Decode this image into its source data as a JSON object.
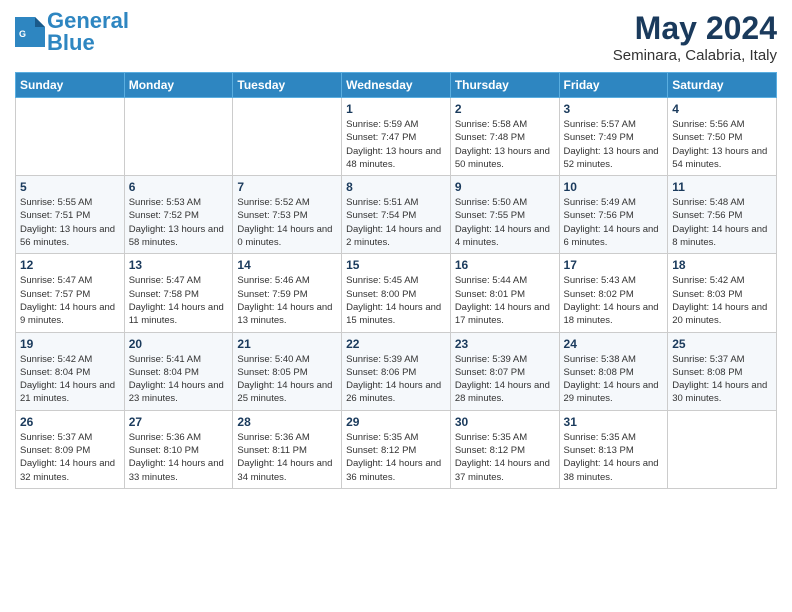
{
  "logo": {
    "text_general": "General",
    "text_blue": "Blue"
  },
  "header": {
    "month_title": "May 2024",
    "location": "Seminara, Calabria, Italy"
  },
  "days_of_week": [
    "Sunday",
    "Monday",
    "Tuesday",
    "Wednesday",
    "Thursday",
    "Friday",
    "Saturday"
  ],
  "weeks": [
    [
      {
        "day": "",
        "sunrise": "",
        "sunset": "",
        "daylight": ""
      },
      {
        "day": "",
        "sunrise": "",
        "sunset": "",
        "daylight": ""
      },
      {
        "day": "",
        "sunrise": "",
        "sunset": "",
        "daylight": ""
      },
      {
        "day": "1",
        "sunrise": "Sunrise: 5:59 AM",
        "sunset": "Sunset: 7:47 PM",
        "daylight": "Daylight: 13 hours and 48 minutes."
      },
      {
        "day": "2",
        "sunrise": "Sunrise: 5:58 AM",
        "sunset": "Sunset: 7:48 PM",
        "daylight": "Daylight: 13 hours and 50 minutes."
      },
      {
        "day": "3",
        "sunrise": "Sunrise: 5:57 AM",
        "sunset": "Sunset: 7:49 PM",
        "daylight": "Daylight: 13 hours and 52 minutes."
      },
      {
        "day": "4",
        "sunrise": "Sunrise: 5:56 AM",
        "sunset": "Sunset: 7:50 PM",
        "daylight": "Daylight: 13 hours and 54 minutes."
      }
    ],
    [
      {
        "day": "5",
        "sunrise": "Sunrise: 5:55 AM",
        "sunset": "Sunset: 7:51 PM",
        "daylight": "Daylight: 13 hours and 56 minutes."
      },
      {
        "day": "6",
        "sunrise": "Sunrise: 5:53 AM",
        "sunset": "Sunset: 7:52 PM",
        "daylight": "Daylight: 13 hours and 58 minutes."
      },
      {
        "day": "7",
        "sunrise": "Sunrise: 5:52 AM",
        "sunset": "Sunset: 7:53 PM",
        "daylight": "Daylight: 14 hours and 0 minutes."
      },
      {
        "day": "8",
        "sunrise": "Sunrise: 5:51 AM",
        "sunset": "Sunset: 7:54 PM",
        "daylight": "Daylight: 14 hours and 2 minutes."
      },
      {
        "day": "9",
        "sunrise": "Sunrise: 5:50 AM",
        "sunset": "Sunset: 7:55 PM",
        "daylight": "Daylight: 14 hours and 4 minutes."
      },
      {
        "day": "10",
        "sunrise": "Sunrise: 5:49 AM",
        "sunset": "Sunset: 7:56 PM",
        "daylight": "Daylight: 14 hours and 6 minutes."
      },
      {
        "day": "11",
        "sunrise": "Sunrise: 5:48 AM",
        "sunset": "Sunset: 7:56 PM",
        "daylight": "Daylight: 14 hours and 8 minutes."
      }
    ],
    [
      {
        "day": "12",
        "sunrise": "Sunrise: 5:47 AM",
        "sunset": "Sunset: 7:57 PM",
        "daylight": "Daylight: 14 hours and 9 minutes."
      },
      {
        "day": "13",
        "sunrise": "Sunrise: 5:47 AM",
        "sunset": "Sunset: 7:58 PM",
        "daylight": "Daylight: 14 hours and 11 minutes."
      },
      {
        "day": "14",
        "sunrise": "Sunrise: 5:46 AM",
        "sunset": "Sunset: 7:59 PM",
        "daylight": "Daylight: 14 hours and 13 minutes."
      },
      {
        "day": "15",
        "sunrise": "Sunrise: 5:45 AM",
        "sunset": "Sunset: 8:00 PM",
        "daylight": "Daylight: 14 hours and 15 minutes."
      },
      {
        "day": "16",
        "sunrise": "Sunrise: 5:44 AM",
        "sunset": "Sunset: 8:01 PM",
        "daylight": "Daylight: 14 hours and 17 minutes."
      },
      {
        "day": "17",
        "sunrise": "Sunrise: 5:43 AM",
        "sunset": "Sunset: 8:02 PM",
        "daylight": "Daylight: 14 hours and 18 minutes."
      },
      {
        "day": "18",
        "sunrise": "Sunrise: 5:42 AM",
        "sunset": "Sunset: 8:03 PM",
        "daylight": "Daylight: 14 hours and 20 minutes."
      }
    ],
    [
      {
        "day": "19",
        "sunrise": "Sunrise: 5:42 AM",
        "sunset": "Sunset: 8:04 PM",
        "daylight": "Daylight: 14 hours and 21 minutes."
      },
      {
        "day": "20",
        "sunrise": "Sunrise: 5:41 AM",
        "sunset": "Sunset: 8:04 PM",
        "daylight": "Daylight: 14 hours and 23 minutes."
      },
      {
        "day": "21",
        "sunrise": "Sunrise: 5:40 AM",
        "sunset": "Sunset: 8:05 PM",
        "daylight": "Daylight: 14 hours and 25 minutes."
      },
      {
        "day": "22",
        "sunrise": "Sunrise: 5:39 AM",
        "sunset": "Sunset: 8:06 PM",
        "daylight": "Daylight: 14 hours and 26 minutes."
      },
      {
        "day": "23",
        "sunrise": "Sunrise: 5:39 AM",
        "sunset": "Sunset: 8:07 PM",
        "daylight": "Daylight: 14 hours and 28 minutes."
      },
      {
        "day": "24",
        "sunrise": "Sunrise: 5:38 AM",
        "sunset": "Sunset: 8:08 PM",
        "daylight": "Daylight: 14 hours and 29 minutes."
      },
      {
        "day": "25",
        "sunrise": "Sunrise: 5:37 AM",
        "sunset": "Sunset: 8:08 PM",
        "daylight": "Daylight: 14 hours and 30 minutes."
      }
    ],
    [
      {
        "day": "26",
        "sunrise": "Sunrise: 5:37 AM",
        "sunset": "Sunset: 8:09 PM",
        "daylight": "Daylight: 14 hours and 32 minutes."
      },
      {
        "day": "27",
        "sunrise": "Sunrise: 5:36 AM",
        "sunset": "Sunset: 8:10 PM",
        "daylight": "Daylight: 14 hours and 33 minutes."
      },
      {
        "day": "28",
        "sunrise": "Sunrise: 5:36 AM",
        "sunset": "Sunset: 8:11 PM",
        "daylight": "Daylight: 14 hours and 34 minutes."
      },
      {
        "day": "29",
        "sunrise": "Sunrise: 5:35 AM",
        "sunset": "Sunset: 8:12 PM",
        "daylight": "Daylight: 14 hours and 36 minutes."
      },
      {
        "day": "30",
        "sunrise": "Sunrise: 5:35 AM",
        "sunset": "Sunset: 8:12 PM",
        "daylight": "Daylight: 14 hours and 37 minutes."
      },
      {
        "day": "31",
        "sunrise": "Sunrise: 5:35 AM",
        "sunset": "Sunset: 8:13 PM",
        "daylight": "Daylight: 14 hours and 38 minutes."
      },
      {
        "day": "",
        "sunrise": "",
        "sunset": "",
        "daylight": ""
      }
    ]
  ]
}
